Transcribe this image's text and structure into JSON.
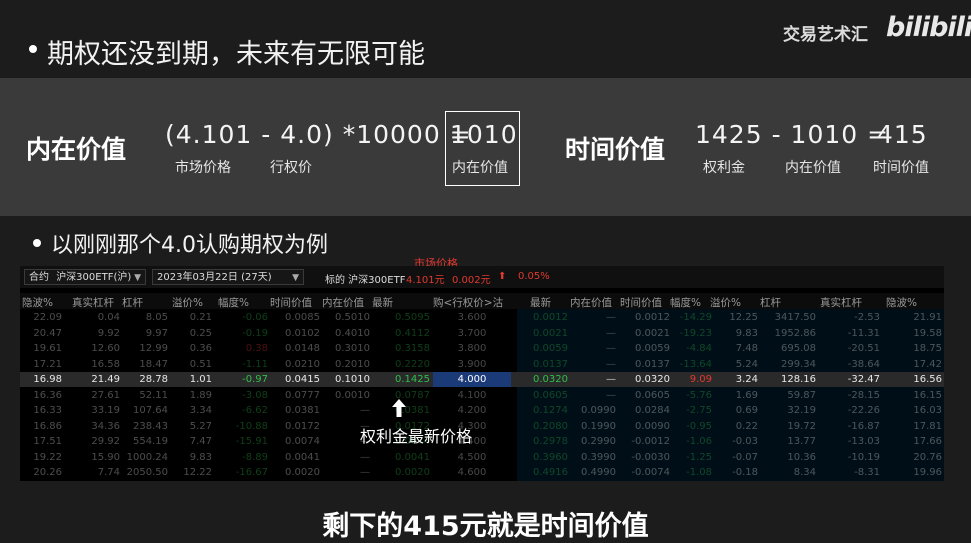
{
  "brand": {
    "channel": "交易艺术汇",
    "logo": "bilibili"
  },
  "heading1": "期权还没到期，未来有无限可能",
  "intrinsic": {
    "title": "内在价值",
    "formula": "(4.101 - 4.0) *10000 =",
    "result": "1010",
    "label_market": "市场价格",
    "label_strike": "行权价",
    "label_result": "内在价值"
  },
  "time_value": {
    "title": "时间价值",
    "formula": "1425 - 1010 =",
    "result": "415",
    "label_premium": "权利金",
    "label_intrinsic": "内在价值",
    "label_time": "时间价值"
  },
  "heading2": "以刚刚那个4.0认购期权为例",
  "market_price_label": "市场价格",
  "toolbar": {
    "contract_prefix": "合约",
    "contract_value": "沪深300ETF(沪)",
    "expiry_value": "2023年03月22日 (27天)",
    "underlying_label": "标的 沪深300ETF",
    "underlying_price": "4.101元",
    "underlying_change": "0.002元",
    "underlying_pct": "0.05%"
  },
  "columns_left": [
    "隐波%",
    "真实杠杆",
    "杠杆",
    "溢价%",
    "幅度%",
    "时间价值",
    "内在价值",
    "最新"
  ],
  "strike_header": "购<行权价>沽",
  "columns_right": [
    "最新",
    "内在价值",
    "时间价值",
    "幅度%",
    "溢价%",
    "杠杆",
    "真实杠杆",
    "隐波%"
  ],
  "rows": [
    {
      "l": [
        "22.09",
        "0.04",
        "8.05",
        "0.21",
        "-0.06",
        "0.0085",
        "0.5010",
        "0.5095"
      ],
      "k": "3.600",
      "r": [
        "0.0012",
        "—",
        "0.0012",
        "-14.29",
        "12.25",
        "3417.50",
        "-2.53",
        "21.91"
      ]
    },
    {
      "l": [
        "20.47",
        "9.92",
        "9.97",
        "0.25",
        "-0.19",
        "0.0102",
        "0.4010",
        "0.4112"
      ],
      "k": "3.700",
      "r": [
        "0.0021",
        "—",
        "0.0021",
        "-19.23",
        "9.83",
        "1952.86",
        "-11.31",
        "19.58"
      ]
    },
    {
      "l": [
        "19.61",
        "12.60",
        "12.99",
        "0.36",
        "0.38",
        "0.0148",
        "0.3010",
        "0.3158"
      ],
      "k": "3.800",
      "r": [
        "0.0059",
        "—",
        "0.0059",
        "-4.84",
        "7.48",
        "695.08",
        "-20.51",
        "18.75"
      ]
    },
    {
      "l": [
        "17.21",
        "16.58",
        "18.47",
        "0.51",
        "-1.11",
        "0.0210",
        "0.2010",
        "0.2220"
      ],
      "k": "3.900",
      "r": [
        "0.0137",
        "—",
        "0.0137",
        "-13.64",
        "5.24",
        "299.34",
        "-38.64",
        "17.42"
      ]
    },
    {
      "l": [
        "16.98",
        "21.49",
        "28.78",
        "1.01",
        "-0.97",
        "0.0415",
        "0.1010",
        "0.1425"
      ],
      "k": "4.000",
      "r": [
        "0.0320",
        "—",
        "0.0320",
        "9.09",
        "3.24",
        "128.16",
        "-32.47",
        "16.56"
      ]
    },
    {
      "l": [
        "16.36",
        "27.61",
        "52.11",
        "1.89",
        "-3.08",
        "0.0777",
        "0.0010",
        "0.0787"
      ],
      "k": "4.100",
      "r": [
        "0.0605",
        "—",
        "0.0605",
        "-5.76",
        "1.69",
        "59.87",
        "-28.15",
        "16.15"
      ]
    },
    {
      "l": [
        "16.33",
        "33.19",
        "107.64",
        "3.34",
        "-6.62",
        "0.0381",
        "—",
        "0.0381"
      ],
      "k": "4.200",
      "r": [
        "0.1274",
        "0.0990",
        "0.0284",
        "-2.75",
        "0.69",
        "32.19",
        "-22.26",
        "16.03"
      ]
    },
    {
      "l": [
        "16.86",
        "34.36",
        "238.43",
        "5.27",
        "-10.88",
        "0.0172",
        "—",
        "0.0172"
      ],
      "k": "4.300",
      "r": [
        "0.2080",
        "0.1990",
        "0.0090",
        "-0.95",
        "0.22",
        "19.72",
        "-16.87",
        "17.81"
      ]
    },
    {
      "l": [
        "17.51",
        "29.92",
        "554.19",
        "7.47",
        "-15.91",
        "0.0074",
        "—",
        "0.0074"
      ],
      "k": "4.400",
      "r": [
        "0.2978",
        "0.2990",
        "-0.0012",
        "-1.06",
        "-0.03",
        "13.77",
        "-13.03",
        "17.66"
      ]
    },
    {
      "l": [
        "19.22",
        "15.90",
        "1000.24",
        "9.83",
        "-8.89",
        "0.0041",
        "—",
        "0.0041"
      ],
      "k": "4.500",
      "r": [
        "0.3960",
        "0.3990",
        "-0.0030",
        "-1.25",
        "-0.07",
        "10.36",
        "-10.19",
        "20.76"
      ]
    },
    {
      "l": [
        "20.26",
        "7.74",
        "2050.50",
        "12.22",
        "-16.67",
        "0.0020",
        "—",
        "0.0020"
      ],
      "k": "4.600",
      "r": [
        "0.4916",
        "0.4990",
        "-0.0074",
        "-1.08",
        "-0.18",
        "8.34",
        "-8.31",
        "19.96"
      ]
    }
  ],
  "annotation": "权利金最新价格",
  "subtitle": "剩下的415元就是时间价值",
  "colors": {
    "red": "#e0392f",
    "green": "#2fbf4a",
    "blue_hl": "#1a3a78"
  }
}
